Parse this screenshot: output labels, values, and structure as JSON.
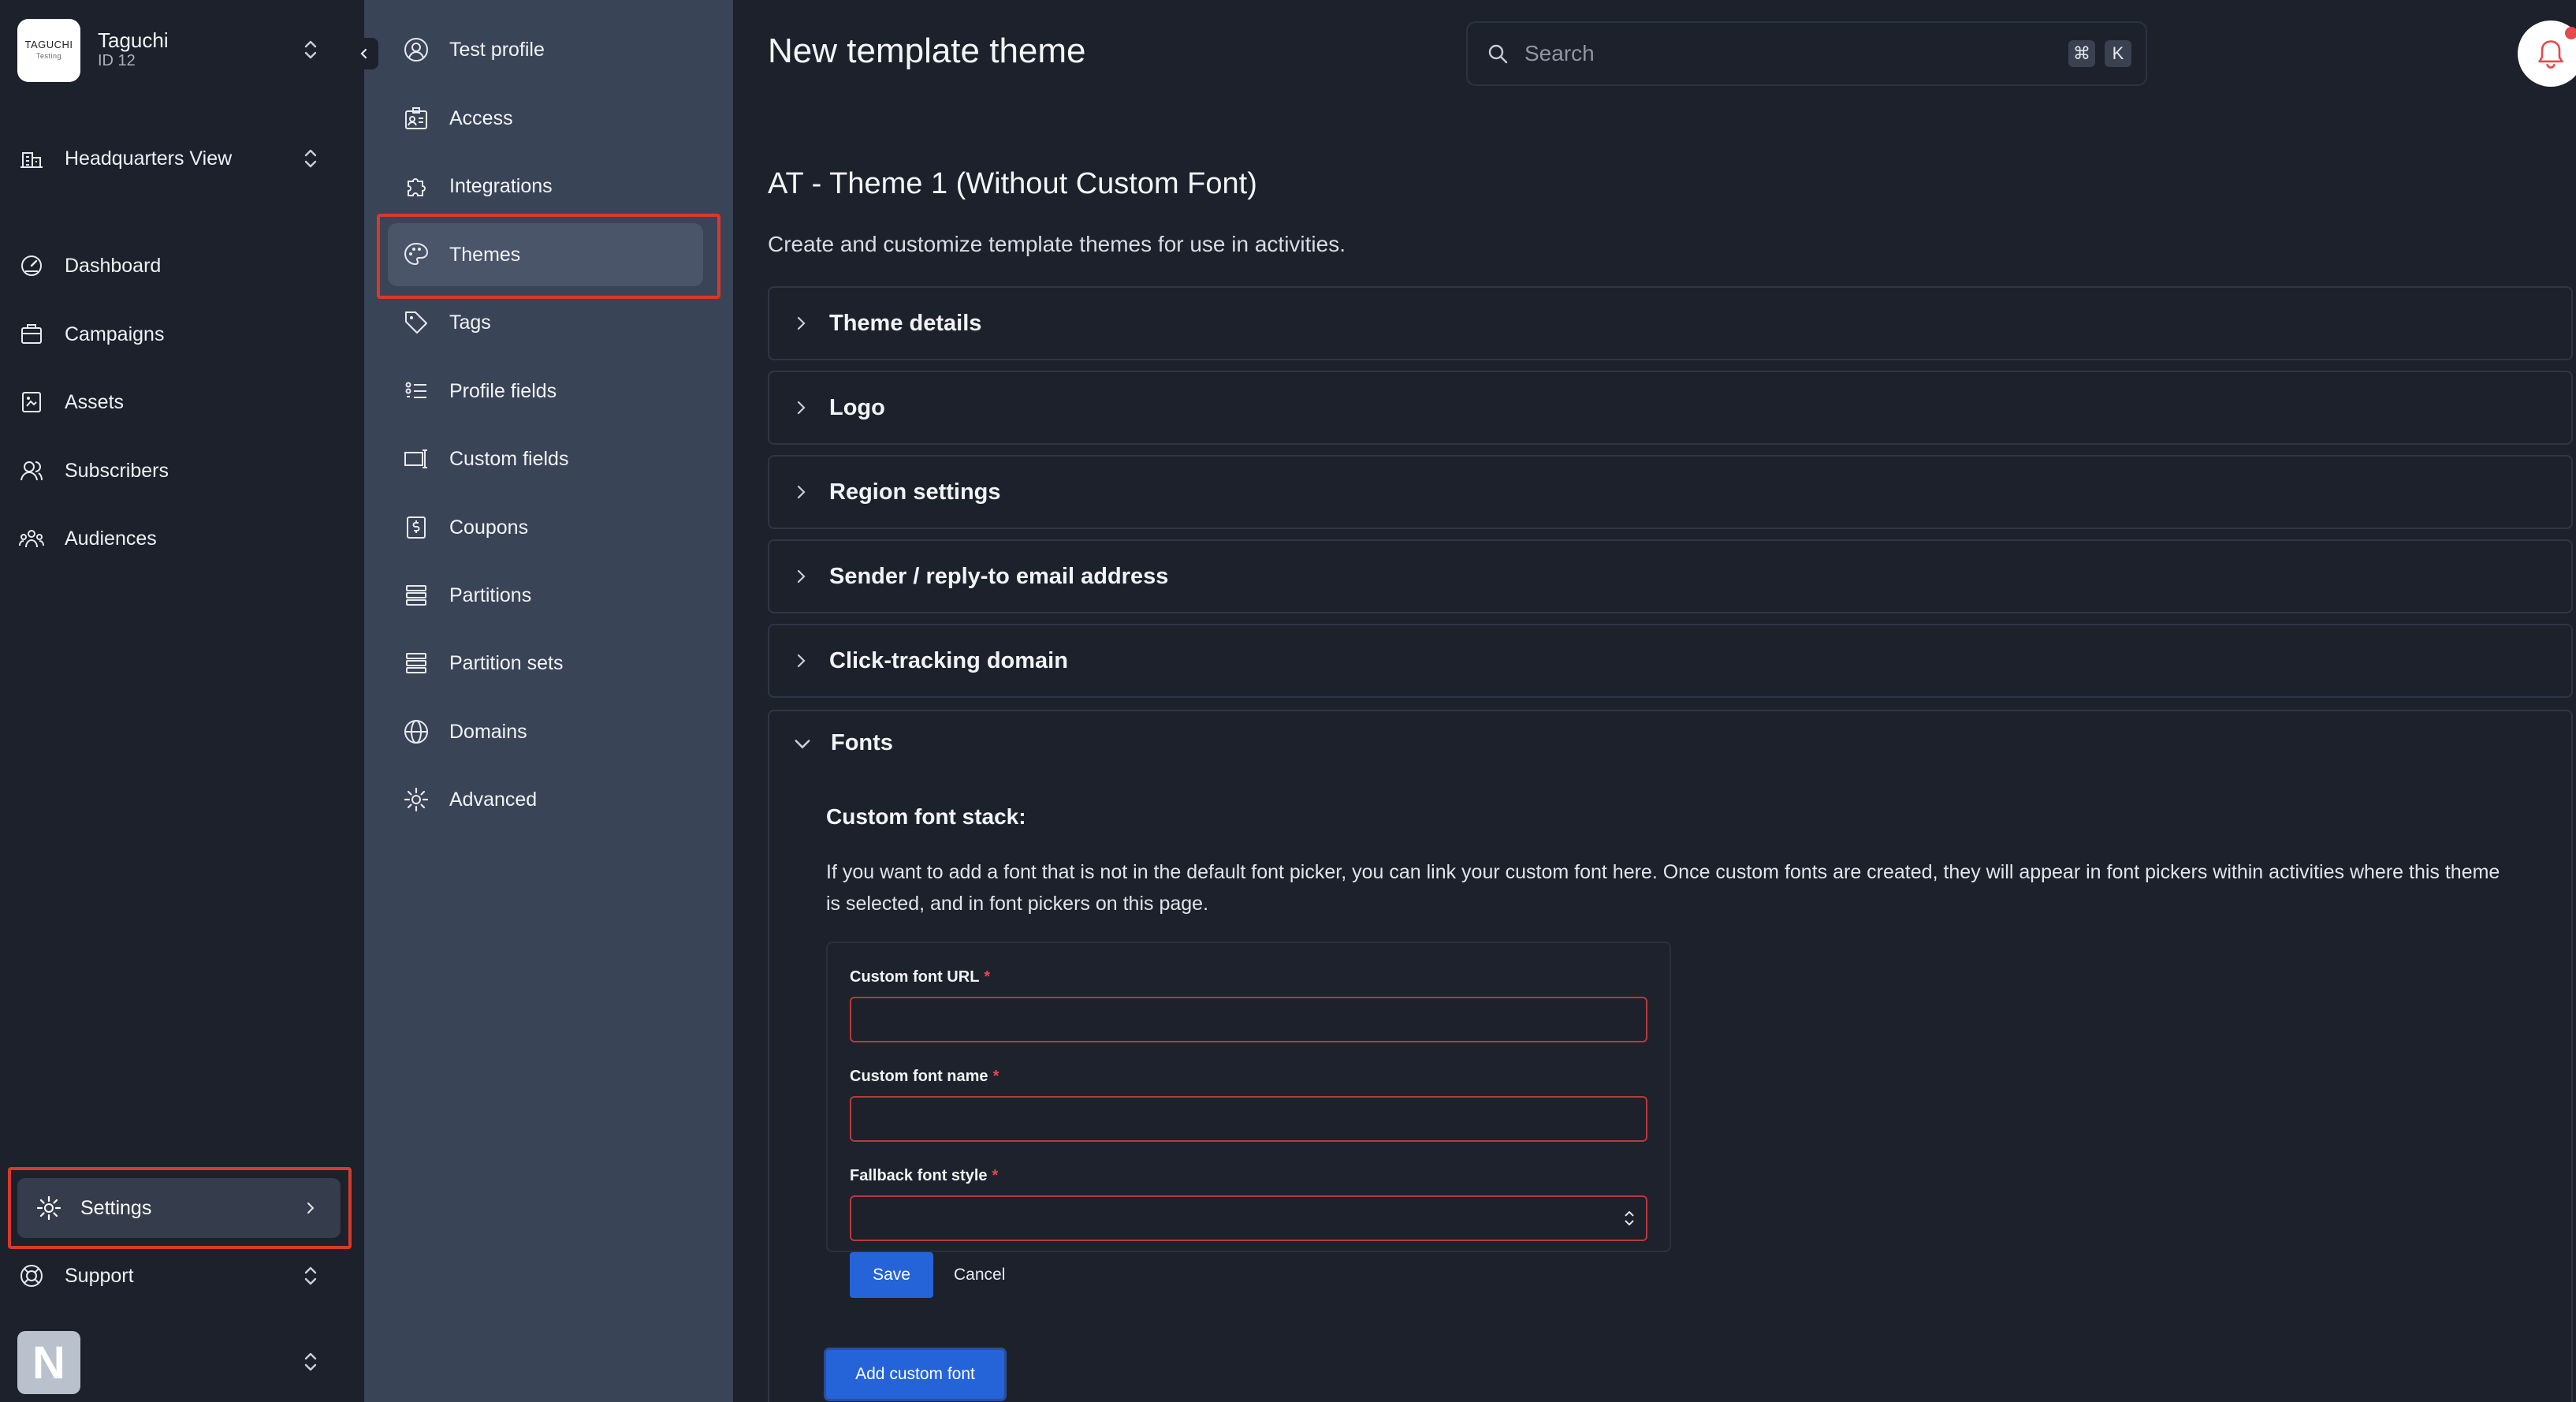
{
  "org": {
    "logo_text": "TAGUCHI",
    "logo_subtext": "Testing",
    "name": "Taguchi",
    "id": "ID 12"
  },
  "view_selector": {
    "label": "Headquarters View"
  },
  "main_nav": {
    "items": [
      {
        "label": "Dashboard",
        "icon": "dashboard-icon"
      },
      {
        "label": "Campaigns",
        "icon": "campaigns-icon"
      },
      {
        "label": "Assets",
        "icon": "assets-icon"
      },
      {
        "label": "Subscribers",
        "icon": "subscribers-icon"
      },
      {
        "label": "Audiences",
        "icon": "audiences-icon"
      }
    ],
    "settings_label": "Settings",
    "support_label": "Support"
  },
  "user": {
    "avatar_letter": "N"
  },
  "settings_menu": {
    "active": "Themes",
    "items": [
      {
        "label": "Test profile",
        "icon": "user-circle-icon"
      },
      {
        "label": "Access",
        "icon": "id-card-icon"
      },
      {
        "label": "Integrations",
        "icon": "puzzle-icon"
      },
      {
        "label": "Themes",
        "icon": "palette-icon"
      },
      {
        "label": "Tags",
        "icon": "tag-icon"
      },
      {
        "label": "Profile fields",
        "icon": "list-icon"
      },
      {
        "label": "Custom fields",
        "icon": "custom-field-icon"
      },
      {
        "label": "Coupons",
        "icon": "coupon-icon"
      },
      {
        "label": "Partitions",
        "icon": "stack-icon"
      },
      {
        "label": "Partition sets",
        "icon": "stack-icon"
      },
      {
        "label": "Domains",
        "icon": "globe-icon"
      },
      {
        "label": "Advanced",
        "icon": "gear-icon"
      }
    ]
  },
  "header": {
    "title": "New template theme",
    "search_placeholder": "Search",
    "shortcut_keys": [
      "⌘",
      "K"
    ]
  },
  "theme": {
    "name": "AT - Theme 1 (Without Custom Font)",
    "description": "Create and customize template themes for use in activities.",
    "sections": [
      {
        "label": "Theme details",
        "expanded": false
      },
      {
        "label": "Logo",
        "expanded": false
      },
      {
        "label": "Region settings",
        "expanded": false
      },
      {
        "label": "Sender / reply-to email address",
        "expanded": false
      },
      {
        "label": "Click-tracking domain",
        "expanded": false
      },
      {
        "label": "Fonts",
        "expanded": true
      }
    ]
  },
  "fonts": {
    "stack_title": "Custom font stack:",
    "stack_description": "If you want to add a font that is not in the default font picker, you can link your custom font here. Once custom fonts are created, they will appear in font pickers within activities where this theme is selected, and in font pickers on this page.",
    "form": {
      "url_label": "Custom font URL",
      "url_value": "",
      "name_label": "Custom font name",
      "name_value": "",
      "fallback_label": "Fallback font style",
      "fallback_value": "",
      "required_mark": "*",
      "save_label": "Save",
      "cancel_label": "Cancel"
    },
    "add_label": "Add custom font"
  },
  "colors": {
    "nav_bg": "#1c212b",
    "submenu_bg": "#3a4457",
    "accent_blue": "#2563d8",
    "highlight_red": "#d8392c",
    "error_border": "#b83a3a"
  }
}
